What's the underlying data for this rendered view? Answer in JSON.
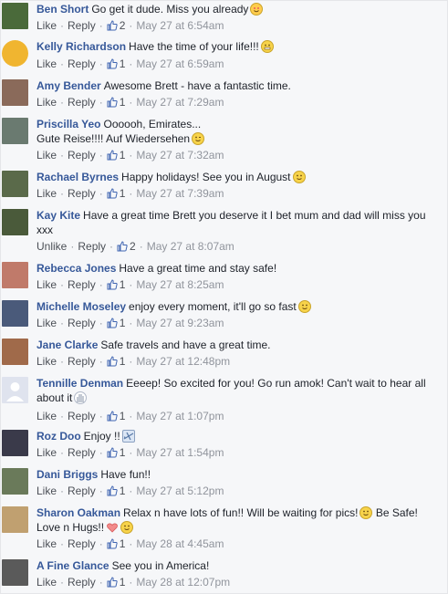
{
  "colors": {
    "author": "#365899",
    "meta": "#90949c",
    "background": "#f6f7f9"
  },
  "comments": [
    {
      "author": "Ben Short",
      "text": "Go get it dude. Miss you already",
      "emoji": "heart-eyes-emoji",
      "action": "Like",
      "reply": "Reply",
      "likes": "2",
      "time": "May 27 at 6:54am",
      "avatar_color": "#4a6a3a"
    },
    {
      "author": "Kelly Richardson",
      "text": "Have the time of your life!!!",
      "emoji": "grin-emoji",
      "action": "Like",
      "reply": "Reply",
      "likes": "1",
      "time": "May 27 at 6:59am",
      "avatar_color": "#f0b530"
    },
    {
      "author": "Amy Bender",
      "text": "Awesome Brett - have a fantastic time.",
      "action": "Like",
      "reply": "Reply",
      "likes": "1",
      "time": "May 27 at 7:29am",
      "avatar_color": "#8a6a5a"
    },
    {
      "author": "Priscilla Yeo",
      "text": "Oooooh, Emirates...",
      "text2": "Gute Reise!!!! Auf Wiedersehen",
      "emoji": "wink-emoji",
      "action": "Like",
      "reply": "Reply",
      "likes": "1",
      "time": "May 27 at 7:32am",
      "avatar_color": "#6a7a70"
    },
    {
      "author": "Rachael Byrnes",
      "text": "Happy holidays! See you in August",
      "emoji": "smile-emoji",
      "action": "Like",
      "reply": "Reply",
      "likes": "1",
      "time": "May 27 at 7:39am",
      "avatar_color": "#5a6a4a"
    },
    {
      "author": "Kay Kite",
      "text": "Have a great time Brett you deserve it I bet mum and dad will miss you",
      "text2": "xxx",
      "action": "Unlike",
      "reply": "Reply",
      "likes": "2",
      "time": "May 27 at 8:07am",
      "avatar_color": "#4a5a3a"
    },
    {
      "author": "Rebecca Jones",
      "text": "Have a great time and stay safe!",
      "action": "Like",
      "reply": "Reply",
      "likes": "1",
      "time": "May 27 at 8:25am",
      "avatar_color": "#c07a6a"
    },
    {
      "author": "Michelle Moseley",
      "text": "enjoy every moment, it'll go so fast",
      "emoji": "smile-emoji",
      "action": "Like",
      "reply": "Reply",
      "likes": "1",
      "time": "May 27 at 9:23am",
      "avatar_color": "#4a5a7a"
    },
    {
      "author": "Jane Clarke",
      "text": "Safe travels and have a great time.",
      "action": "Like",
      "reply": "Reply",
      "likes": "1",
      "time": "May 27 at 12:48pm",
      "avatar_color": "#a06a4a"
    },
    {
      "author": "Tennille Denman",
      "text": "Eeeep! So excited for you! Go run amok! Can't wait to hear all",
      "text2": "about it",
      "emoji": "hand-emoji",
      "action": "Like",
      "reply": "Reply",
      "likes": "1",
      "time": "May 27 at 1:07pm",
      "avatar_color": "#dfe3ee"
    },
    {
      "author": "Roz Doo",
      "text": "Enjoy !!",
      "emoji": "airplane-emoji",
      "action": "Like",
      "reply": "Reply",
      "likes": "1",
      "time": "May 27 at 1:54pm",
      "avatar_color": "#3a3a4a"
    },
    {
      "author": "Dani Briggs",
      "text": "Have fun!!",
      "action": "Like",
      "reply": "Reply",
      "likes": "1",
      "time": "May 27 at 5:12pm",
      "avatar_color": "#6a7a5a"
    },
    {
      "author": "Sharon Oakman",
      "text": "Relax n have lots of fun!! Will be waiting for pics!",
      "text_after": "Be Safe!",
      "text2": "Love n Hugs!!",
      "emoji": "smile-emoji",
      "emoji2": "heart-emoji",
      "emoji3": "smile-emoji",
      "action": "Like",
      "reply": "Reply",
      "likes": "1",
      "time": "May 28 at 4:45am",
      "avatar_color": "#c0a070"
    },
    {
      "author": "A Fine Glance",
      "text": "See you in America!",
      "action": "Like",
      "reply": "Reply",
      "likes": "1",
      "time": "May 28 at 12:07pm",
      "avatar_color": "#5a5a5a"
    }
  ]
}
